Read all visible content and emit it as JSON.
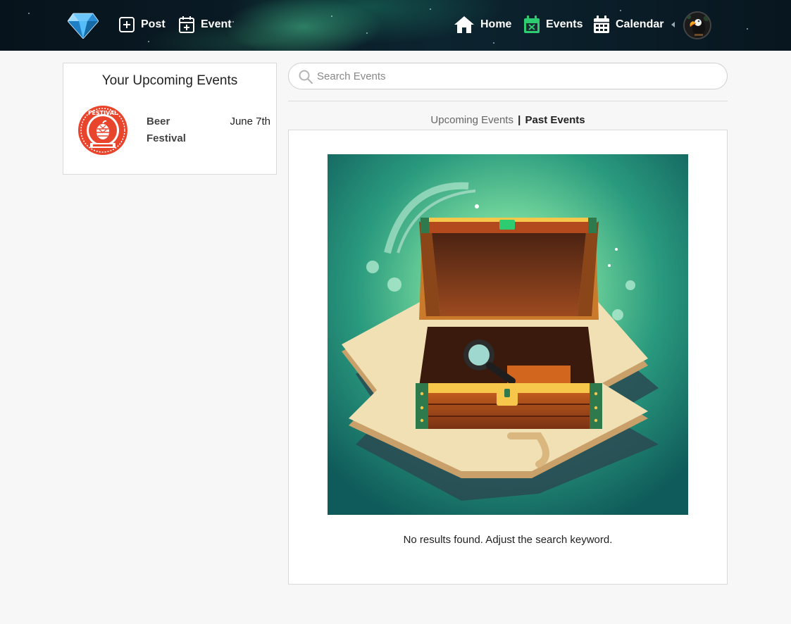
{
  "header": {
    "brand_icon": "diamond-logo",
    "actions": [
      {
        "label": "Post",
        "icon": "plus-square-icon"
      },
      {
        "label": "Event",
        "icon": "calendar-plus-icon"
      }
    ],
    "nav": [
      {
        "label": "Home",
        "icon": "home-icon"
      },
      {
        "label": "Events",
        "icon": "calendar-x-icon",
        "icon_color": "#2ecc71"
      },
      {
        "label": "Calendar",
        "icon": "calendar-grid-icon"
      }
    ],
    "avatar": "user-avatar-toucan"
  },
  "sidebar": {
    "title": "Your Upcoming Events",
    "events": [
      {
        "name": "Beer Festival",
        "date": "June 7th",
        "logo": "festival-badge",
        "logo_text": "FESTIVAL",
        "logo_color": "#e8452c"
      }
    ]
  },
  "search": {
    "placeholder": "Search Events",
    "value": ""
  },
  "tabs": {
    "upcoming": "Upcoming Events",
    "separator": "|",
    "past": "Past Events",
    "active": "past"
  },
  "results": {
    "illustration": "empty-treasure-chest",
    "empty_message": "No results found. Adjust the search keyword."
  },
  "colors": {
    "header_bg": "#0a1b25",
    "events_accent": "#2ecc71",
    "festival_red": "#e8452c"
  }
}
